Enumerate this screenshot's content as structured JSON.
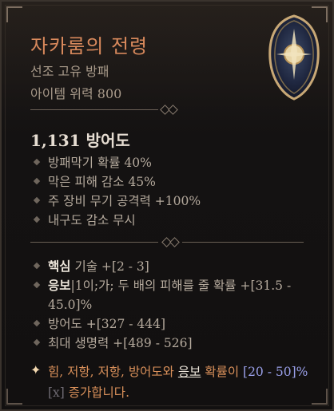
{
  "item": {
    "name": "자카룸의 전령",
    "type": "선조 고유 방패",
    "power": "아이템 위력 800",
    "armor": "1,131 방어도"
  },
  "implicit_stats": [
    "방패막기 확률 40%",
    "막은 피해 감소 45%",
    "주 장비 무기 공격력 +100%",
    "내구도 감소 무시"
  ],
  "affixes": {
    "a1_bold": "핵심",
    "a1_rest": " 기술 +[2 - 3]",
    "a2_bold": "응보",
    "a2_rest": "|1이;가; 두 배의 피해를 줄 확률 +[31.5 - 45.0]%",
    "a3": "방어도 +[327 - 444]",
    "a4": "최대 생명력 +[489 - 526]"
  },
  "legendary": {
    "prefix": "힘, 저항, 저항, 방어도와 ",
    "underlined": "응보",
    "mid": " 확률이 ",
    "range": "[20 - 50]%",
    "x": "[x]",
    "suffix": " 증가합니다."
  },
  "colors": {
    "name": "#d8895c",
    "legendary_text": "#d9905a",
    "range": "#9aa0ea"
  },
  "icons": [
    "shield-icon",
    "diamond-bullet-icon",
    "legendary-star-icon"
  ]
}
